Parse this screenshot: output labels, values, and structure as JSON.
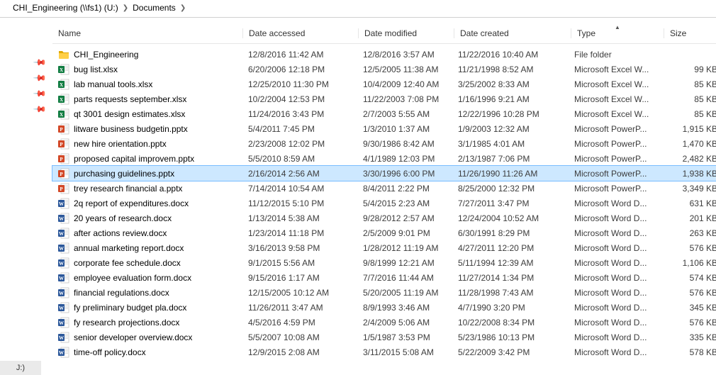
{
  "breadcrumb": {
    "drive": "CHI_Engineering (\\\\fs1) (U:)",
    "folder": "Documents"
  },
  "columns": {
    "name": "Name",
    "accessed": "Date accessed",
    "modified": "Date modified",
    "created": "Date created",
    "type": "Type",
    "size": "Size"
  },
  "status_drive": "J:)",
  "rows": [
    {
      "icon": "folder",
      "name": "CHI_Engineering",
      "accessed": "12/8/2016 11:42 AM",
      "modified": "12/8/2016 3:57 AM",
      "created": "11/22/2016 10:40 AM",
      "type": "File folder",
      "size": ""
    },
    {
      "icon": "excel",
      "name": "bug list.xlsx",
      "accessed": "6/20/2006 12:18 PM",
      "modified": "12/5/2005 11:38 AM",
      "created": "11/21/1998 8:52 AM",
      "type": "Microsoft Excel W...",
      "size": "99 KB"
    },
    {
      "icon": "excel",
      "name": "lab manual tools.xlsx",
      "accessed": "12/25/2010 11:30 PM",
      "modified": "10/4/2009 12:40 AM",
      "created": "3/25/2002 8:33 AM",
      "type": "Microsoft Excel W...",
      "size": "85 KB"
    },
    {
      "icon": "excel",
      "name": "parts requests september.xlsx",
      "accessed": "10/2/2004 12:53 PM",
      "modified": "11/22/2003 7:08 PM",
      "created": "1/16/1996 9:21 AM",
      "type": "Microsoft Excel W...",
      "size": "85 KB"
    },
    {
      "icon": "excel",
      "name": "qt 3001 design estimates.xlsx",
      "accessed": "11/24/2016 3:43 PM",
      "modified": "2/7/2003 5:55 AM",
      "created": "12/22/1996 10:28 PM",
      "type": "Microsoft Excel W...",
      "size": "85 KB"
    },
    {
      "icon": "ppt",
      "name": "litware business budgetin.pptx",
      "accessed": "5/4/2011 7:45 PM",
      "modified": "1/3/2010 1:37 AM",
      "created": "1/9/2003 12:32 AM",
      "type": "Microsoft PowerP...",
      "size": "1,915 KB"
    },
    {
      "icon": "ppt",
      "name": "new hire orientation.pptx",
      "accessed": "2/23/2008 12:02 PM",
      "modified": "9/30/1986 8:42 AM",
      "created": "3/1/1985 4:01 AM",
      "type": "Microsoft PowerP...",
      "size": "1,470 KB"
    },
    {
      "icon": "ppt",
      "name": "proposed capital improvem.pptx",
      "accessed": "5/5/2010 8:59 AM",
      "modified": "4/1/1989 12:03 PM",
      "created": "2/13/1987 7:06 PM",
      "type": "Microsoft PowerP...",
      "size": "2,482 KB"
    },
    {
      "icon": "ppt",
      "name": "purchasing guidelines.pptx",
      "accessed": "2/16/2014 2:56 AM",
      "modified": "3/30/1996 6:00 PM",
      "created": "11/26/1990 11:26 AM",
      "type": "Microsoft PowerP...",
      "size": "1,938 KB",
      "selected": true
    },
    {
      "icon": "ppt",
      "name": "trey research financial a.pptx",
      "accessed": "7/14/2014 10:54 AM",
      "modified": "8/4/2011 2:22 PM",
      "created": "8/25/2000 12:32 PM",
      "type": "Microsoft PowerP...",
      "size": "3,349 KB"
    },
    {
      "icon": "word",
      "name": "2q report of expenditures.docx",
      "accessed": "11/12/2015 5:10 PM",
      "modified": "5/4/2015 2:23 AM",
      "created": "7/27/2011 3:47 PM",
      "type": "Microsoft Word D...",
      "size": "631 KB"
    },
    {
      "icon": "word",
      "name": "20 years of research.docx",
      "accessed": "1/13/2014 5:38 AM",
      "modified": "9/28/2012 2:57 AM",
      "created": "12/24/2004 10:52 AM",
      "type": "Microsoft Word D...",
      "size": "201 KB"
    },
    {
      "icon": "word",
      "name": "after actions review.docx",
      "accessed": "1/23/2014 11:18 PM",
      "modified": "2/5/2009 9:01 PM",
      "created": "6/30/1991 8:29 PM",
      "type": "Microsoft Word D...",
      "size": "263 KB"
    },
    {
      "icon": "word",
      "name": "annual marketing report.docx",
      "accessed": "3/16/2013 9:58 PM",
      "modified": "1/28/2012 11:19 AM",
      "created": "4/27/2011 12:20 PM",
      "type": "Microsoft Word D...",
      "size": "576 KB"
    },
    {
      "icon": "word",
      "name": "corporate fee schedule.docx",
      "accessed": "9/1/2015 5:56 AM",
      "modified": "9/8/1999 12:21 AM",
      "created": "5/11/1994 12:39 AM",
      "type": "Microsoft Word D...",
      "size": "1,106 KB"
    },
    {
      "icon": "word",
      "name": "employee evaluation form.docx",
      "accessed": "9/15/2016 1:17 AM",
      "modified": "7/7/2016 11:44 AM",
      "created": "11/27/2014 1:34 PM",
      "type": "Microsoft Word D...",
      "size": "574 KB"
    },
    {
      "icon": "word",
      "name": "financial regulations.docx",
      "accessed": "12/15/2005 10:12 AM",
      "modified": "5/20/2005 11:19 AM",
      "created": "11/28/1998 7:43 AM",
      "type": "Microsoft Word D...",
      "size": "576 KB"
    },
    {
      "icon": "word",
      "name": "fy preliminary budget pla.docx",
      "accessed": "11/26/2011 3:47 AM",
      "modified": "8/9/1993 3:46 AM",
      "created": "4/7/1990 3:20 PM",
      "type": "Microsoft Word D...",
      "size": "345 KB"
    },
    {
      "icon": "word",
      "name": "fy research projections.docx",
      "accessed": "4/5/2016 4:59 PM",
      "modified": "2/4/2009 5:06 AM",
      "created": "10/22/2008 8:34 PM",
      "type": "Microsoft Word D...",
      "size": "576 KB"
    },
    {
      "icon": "word",
      "name": "senior developer overview.docx",
      "accessed": "5/5/2007 10:08 AM",
      "modified": "1/5/1987 3:53 PM",
      "created": "5/23/1986 10:13 PM",
      "type": "Microsoft Word D...",
      "size": "335 KB"
    },
    {
      "icon": "word",
      "name": "time-off policy.docx",
      "accessed": "12/9/2015 2:08 AM",
      "modified": "3/11/2015 5:08 AM",
      "created": "5/22/2009 3:42 PM",
      "type": "Microsoft Word D...",
      "size": "578 KB"
    }
  ]
}
